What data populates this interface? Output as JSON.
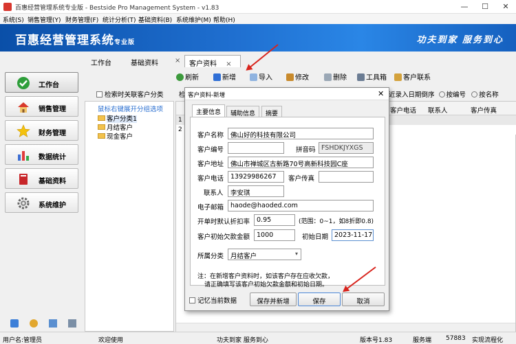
{
  "window": {
    "title": "百惠经营管理系统专业版 - Bestside Pro Management System - v1.83",
    "minimize": "—",
    "maximize": "☐",
    "close": "✕"
  },
  "menu": [
    "系统(S)",
    "销售管理(Y)",
    "财务管理(F)",
    "统计分析(T)",
    "基础资料(B)",
    "系统维护(M)",
    "帮助(H)"
  ],
  "banner": {
    "brand": "百惠经营管理系统",
    "edition": "专业版",
    "slogan": "功夫到家 服务到心"
  },
  "nav": [
    "工作台",
    "销售管理",
    "财务管理",
    "数据统计",
    "基础资料",
    "系统维护"
  ],
  "tabs": {
    "t1": "工作台",
    "t2": "基础资料",
    "t3": "客户资料",
    "close": "×"
  },
  "toolbar": [
    "刷新",
    "新增",
    "导入",
    "修改",
    "删除",
    "工具箱",
    "客户联系"
  ],
  "tree": {
    "checkbox_label": "检索时关联客户分类",
    "hint": "鼠标右键展开分组选项",
    "items": [
      "客户分类1",
      "月结客户",
      "现金客户"
    ]
  },
  "grid": {
    "search_fragment": "检",
    "sort_label": "近录入日期倒序",
    "radio_code": "按编号",
    "radio_name": "按名称",
    "headers": [
      "客户电话",
      "联系人",
      "客户传真"
    ],
    "rows": [
      "1",
      "2"
    ]
  },
  "dialog": {
    "title": "客户资料-新增",
    "close": "✕",
    "tabs": [
      "主要信息",
      "辅助信息",
      "摘要"
    ],
    "labels": {
      "name": "客户名称",
      "code": "客户编号",
      "pinyin": "拼音码",
      "address": "客户地址",
      "phone": "客户电话",
      "fax": "客户传真",
      "contact": "联系人",
      "email": "电子邮箱",
      "discount": "开单时默认折扣率",
      "discount_hint": "(范围：0~1，如8折即0.8)",
      "init_debt": "客户初始欠款金额",
      "init_date": "初始日期",
      "category": "所属分类"
    },
    "values": {
      "name": "佛山好的科技有限公司",
      "code": "",
      "pinyin": "FSHDKJYXGS",
      "address": "佛山市禅城区古新路70号高新科技园C座",
      "phone": "13929986267",
      "fax": "",
      "contact": "李安琪",
      "email": "haode@haoded.com",
      "discount": "0.95",
      "init_debt": "1000",
      "init_date": "2023-11-17",
      "category": "月结客户"
    },
    "note_line1": "注：在新增客户资料时，如该客户存在应收欠款，",
    "note_line2": "请正确填写该客户初始欠款金额和初始日期。",
    "remember": "记忆当前数据",
    "btn_save_new": "保存并新增",
    "btn_save": "保存",
    "btn_cancel": "取消"
  },
  "status": {
    "user": "用户名:管理员",
    "welcome": "欢迎使用",
    "slogan": "功夫到家 服务到心",
    "version": "版本号1.83",
    "server": "服务端",
    "port": "57883",
    "flow": "实现流程化"
  }
}
